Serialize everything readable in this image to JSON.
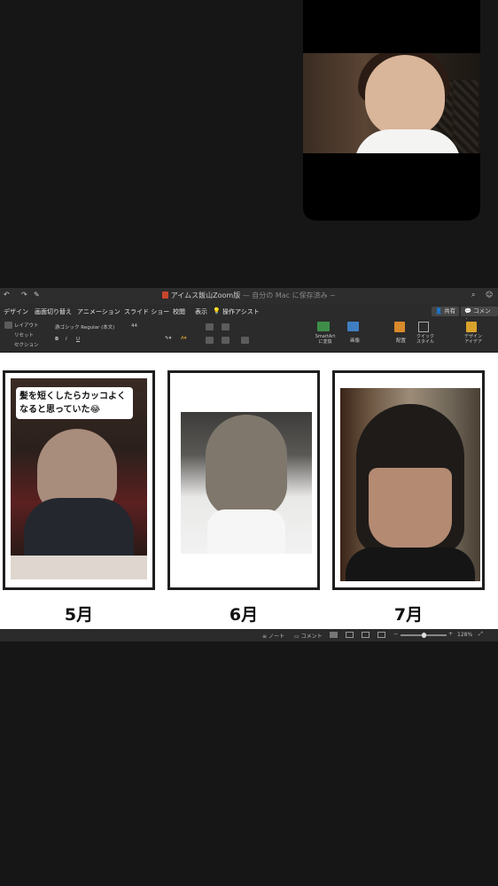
{
  "document": {
    "title": "アイムス飯山Zoom版",
    "save_status": "— 自分の Mac に保存済み ~"
  },
  "menu": {
    "items": [
      "デザイン",
      "画面切り替え",
      "アニメーション",
      "スライド ショー",
      "校閲",
      "表示"
    ],
    "assist": "操作アシスト",
    "share_label": "共有",
    "comment_label": "コメント"
  },
  "ribbon": {
    "layout_label": "レイアウト",
    "reset_label": "リセット",
    "section_label": "セクション",
    "font_name": "游ゴシック Regular (本文)",
    "font_size": "44",
    "smartart_label": "SmartArt\nに変換",
    "picture_label": "画像",
    "arrange_label": "配置",
    "quickstyle_label": "クイック\nスタイル",
    "design_ideas_label": "デザイン\nアイデア"
  },
  "slide": {
    "callout_text": "髪を短くしたらカッコよくなると思っていた😂",
    "captions": [
      "5月",
      "6月",
      "7月"
    ]
  },
  "statusbar": {
    "notes_label": "ノート",
    "comments_label": "コメント",
    "zoom_level": "128%",
    "zoom_fraction": 0.5
  },
  "colors": {
    "background": "#161616",
    "window_chrome": "#2b2b2b",
    "slide": "#ffffff",
    "card_border": "#1e1e1e"
  }
}
